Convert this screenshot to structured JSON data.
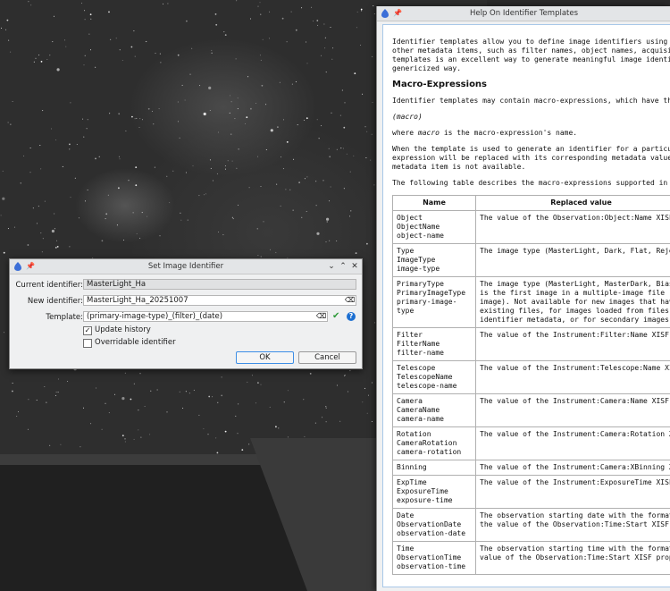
{
  "dialog": {
    "title": "Set Image Identifier",
    "current_identifier_label": "Current identifier:",
    "current_identifier_value": "MasterLight_Ha",
    "new_identifier_label": "New identifier:",
    "new_identifier_value": "MasterLight_Ha_20251007",
    "template_label": "Template:",
    "template_value": "(primary-image-type)_(filter)_(date)",
    "update_history_label": "Update history",
    "update_history_checked": true,
    "overridable_label": "Overridable identifier",
    "overridable_checked": false,
    "ok_label": "OK",
    "cancel_label": "Cancel",
    "check_mark": "✓",
    "empty_mark": "",
    "help_mark": "?",
    "pin_glyph": "📌",
    "minimize_glyph": "⌄",
    "maximize_glyph": "⌃",
    "close_glyph": "✕",
    "clear_glyph": "⌫",
    "confirm_glyph": "✔"
  },
  "help": {
    "title": "Help On Identifier Templates",
    "intro": [
      "Identifier templates allow you to define image identifiers using ex",
      "other metadata items, such as filter names, object names, acquisiti",
      "templates is an excellent way to generate meaningful image identifi",
      "genericized way."
    ],
    "heading": "Macro-Expressions",
    "p1": "Identifier templates may contain macro-expressions, which have the",
    "macro_form": "(macro)",
    "p2": "where macro is the macro-expression's name.",
    "p3": [
      "When the template is used to generate an identifier for a particula",
      "expression will be replaced with its corresponding metadata value,",
      "metadata item is not available."
    ],
    "p4": "The following table describes the macro-expressions supported in th",
    "col_name": "Name",
    "col_value": "Replaced value",
    "rows": [
      {
        "name": "Object\nObjectName\nobject-name",
        "desc": "The value of the Observation:Object:Name XISF p"
      },
      {
        "name": "Type\nImageType\nimage-type",
        "desc": "The image type (MasterLight, Dark, Flat, Reject"
      },
      {
        "name": "PrimaryType\nPrimaryImageType\nprimary-image-type",
        "desc": "The image type (MasterLight, MasterDark, Bias,\nis the first image in a multiple-image file (al\nimage). Not available for new images that have\nexisting files, for images loaded from files th\nidentifier metadata, or for secondary images."
      },
      {
        "name": "Filter\nFilterName\nfilter-name",
        "desc": "The value of the Instrument:Filter:Name XISF pr"
      },
      {
        "name": "Telescope\nTelescopeName\ntelescope-name",
        "desc": "The value of the Instrument:Telescope:Name XISF"
      },
      {
        "name": "Camera\nCameraName\ncamera-name",
        "desc": "The value of the Instrument:Camera:Name XISF pr"
      },
      {
        "name": "Rotation\nCameraRotation\ncamera-rotation",
        "desc": "The value of the Instrument:Camera:Rotation XIS"
      },
      {
        "name": "Binning",
        "desc": "The value of the Instrument:Camera:XBinning XIS"
      },
      {
        "name": "ExpTime\nExposureTime\nexposure-time",
        "desc": "The value of the Instrument:ExposureTime XISF p"
      },
      {
        "name": "Date\nObservationDate\nobservation-date",
        "desc": "The observation starting date with the format Y\nthe value of the Observation:Time:Start XISF pr"
      },
      {
        "name": "Time\nObservationTime\nobservation-time",
        "desc": "The observation starting time with the format H\nvalue of the Observation:Time:Start XISF proper"
      }
    ]
  }
}
